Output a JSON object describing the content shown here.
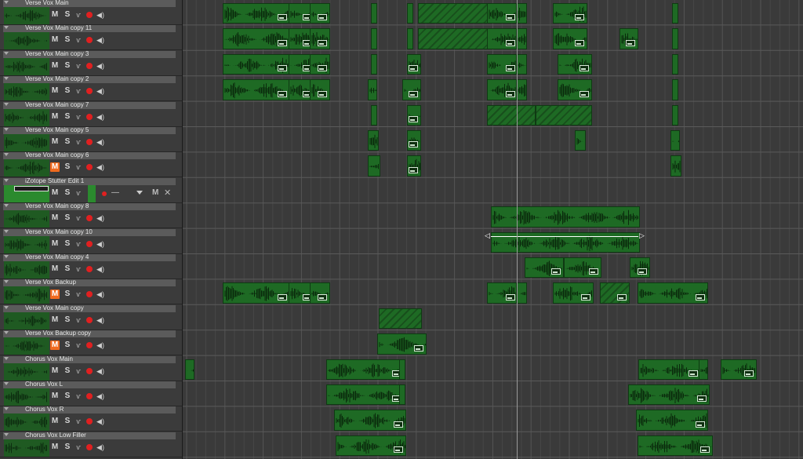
{
  "tracks": [
    {
      "name": "Verse Vox Main",
      "mute_label": "M",
      "solo_label": "S",
      "muted": false
    },
    {
      "name": "Verse Vox Main copy 11",
      "mute_label": "M",
      "solo_label": "S",
      "muted": false
    },
    {
      "name": "Verse Vox Main copy 3",
      "mute_label": "M",
      "solo_label": "S",
      "muted": false
    },
    {
      "name": "Verse Vox Main copy 2",
      "mute_label": "M",
      "solo_label": "S",
      "muted": false
    },
    {
      "name": "Verse Vox Main copy 7",
      "mute_label": "M",
      "solo_label": "S",
      "muted": false
    },
    {
      "name": "Verse Vox Main copy 5",
      "mute_label": "M",
      "solo_label": "S",
      "muted": false
    },
    {
      "name": "Verse Vox Main copy 6",
      "mute_label": "M",
      "solo_label": "S",
      "muted": true
    },
    {
      "name": "iZotope Stutter Edit 1",
      "bus": true,
      "mute_label": "M",
      "solo_label": "S",
      "dash": "—",
      "close_label": "✕"
    },
    {
      "name": "Verse Vox Main copy 8",
      "mute_label": "M",
      "solo_label": "S",
      "muted": false
    },
    {
      "name": "Verse Vox Main copy 10",
      "mute_label": "M",
      "solo_label": "S",
      "muted": false
    },
    {
      "name": "Verse Vox Main copy 4",
      "mute_label": "M",
      "solo_label": "S",
      "muted": false
    },
    {
      "name": "Verse Vox Backup",
      "mute_label": "M",
      "solo_label": "S",
      "muted": true
    },
    {
      "name": "Verse Vox Main copy",
      "mute_label": "M",
      "solo_label": "S",
      "muted": false
    },
    {
      "name": "Verse Vox Backup copy",
      "mute_label": "M",
      "solo_label": "S",
      "muted": true
    },
    {
      "name": "Chorus Vox Main",
      "mute_label": "M",
      "solo_label": "S",
      "muted": false
    },
    {
      "name": "Chorus Vox L",
      "mute_label": "M",
      "solo_label": "S",
      "muted": false
    },
    {
      "name": "Chorus Vox R",
      "mute_label": "M",
      "solo_label": "S",
      "muted": false
    },
    {
      "name": "Chorus Vox Low Filler",
      "mute_label": "M",
      "solo_label": "S",
      "muted": false
    }
  ],
  "colors": {
    "clip": "#1e6a24",
    "clip_border": "#0f3a13",
    "mute_active": "#f06a1e",
    "record": "#e02020",
    "panel": "#3b3b3b",
    "timeline_bg": "#3a3a3a"
  },
  "icons": {
    "fx": "fx-icon",
    "speaker": "speaker-icon",
    "record": "record-arm-icon",
    "fold": "folder-toggle-icon"
  }
}
